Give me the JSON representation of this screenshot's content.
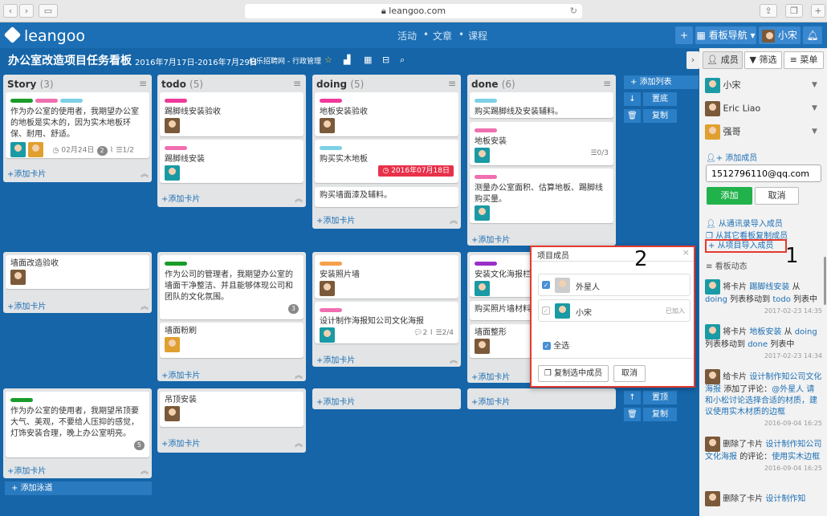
{
  "browser": {
    "url": "leangoo.com"
  },
  "app": {
    "logo": "leangoo",
    "nav": [
      "活动",
      "文章",
      "课程"
    ],
    "board_nav_label": "看板导航",
    "user_name": "小宋",
    "plus_label": "+"
  },
  "board": {
    "title": "办公室改造项目任务看板",
    "dates": "2016年7月17日-2016年7月29日",
    "org": "伯乐招聘网 - 行政管理"
  },
  "lists": [
    {
      "name": "Story",
      "count": "(3)"
    },
    {
      "name": "todo",
      "count": "(5)"
    },
    {
      "name": "doing",
      "count": "(5)"
    },
    {
      "name": "done",
      "count": "(6)"
    }
  ],
  "cards": {
    "story1": "作为办公室的使用者，我期望办公室的地板是实木的，因为实木地板环保、耐用、舒适。",
    "story1_date": "02月24日",
    "story1_comments": "2",
    "story1_check": "1/2",
    "story2": "墙面改造验收",
    "story3": "作为办公室的使用者，我期望吊顶要大气、美观，不要给人压抑的感觉，灯饰安装合理，晚上办公室明亮。",
    "story3_badge": "5",
    "todo1": "踢脚线安装验收",
    "todo2": "踢脚线安装",
    "todo3": "作为公司的管理者，我期望办公室的墙面干净整洁、并且能够体现公司和团队的文化氛围。",
    "todo3_badge": "3",
    "todo4": "墙面粉刷",
    "todo5": "吊顶安装",
    "doing1": "地板安装验收",
    "doing2": "购买实木地板",
    "doing2_due": "2016年07月18日",
    "doing3": "购买墙面漆及辅料。",
    "doing4": "安装照片墙",
    "doing5": "设计制作海报知公司文化海报",
    "doing5_comments": "2",
    "doing5_check": "2/4",
    "done1": "购买踢脚线及安装辅料。",
    "done2": "地板安装",
    "done2_check": "0/3",
    "done3": "测量办公室面积、估算地板、踢脚线购买量。",
    "done4": "安装文化海报栏",
    "done5": "购买照片墙材料",
    "done6": "墙面整形"
  },
  "list_actions": {
    "add_card": "添加卡片",
    "add_list": "添加列表",
    "top": "置底",
    "copy": "复制",
    "top2": "置顶",
    "add_lane": "添加泳道"
  },
  "sidebar": {
    "tabs": [
      "成员",
      "筛选",
      "菜单"
    ],
    "members": [
      "小宋",
      "Eric Liao",
      "强哥"
    ],
    "add_member": "添加成员",
    "email_value": "1512796110@qq.com",
    "add_btn": "添加",
    "cancel_btn": "取消",
    "import_contacts": "从通讯录导入成员",
    "copy_other": "从其它看板复制成员",
    "import_project": "从项目导入成员",
    "activity_title": "看板动态",
    "activities": [
      {
        "pre": "将卡片",
        "card": "踢脚线安装",
        "mid": "从",
        "from": "doing",
        "mid2": "列表移动到",
        "to": "todo",
        "post": "列表中",
        "time": "2017-02-23 14:35"
      },
      {
        "pre": "将卡片",
        "card": "地板安装",
        "mid": "从",
        "from": "doing",
        "mid2": "列表移动到",
        "to": "done",
        "post": "列表中",
        "time": "2017-02-23 14:34"
      },
      {
        "pre": "给卡片",
        "card": "设计制作知公司文化海报",
        "mid": "添加了评论：",
        "from": "@外星人 请和小松讨论选择合适的材质，建议使用实木材质的边框",
        "mid2": "",
        "to": "",
        "post": "",
        "time": "2016-09-04 16:25"
      },
      {
        "pre": "删除了卡片",
        "card": "设计制作知公司文化海报",
        "mid": "的评论：",
        "from": "使用实木边框",
        "mid2": "",
        "to": "",
        "post": "",
        "time": "2016-09-04 16:25"
      },
      {
        "pre": "删除了卡片",
        "card": "设计制作知",
        "mid": "",
        "from": "",
        "mid2": "",
        "to": "",
        "post": "",
        "time": ""
      }
    ]
  },
  "modal": {
    "title": "项目成员",
    "members": [
      {
        "name": "外星人",
        "note": ""
      },
      {
        "name": "小宋",
        "note": "已加入"
      }
    ],
    "select_all": "全选",
    "copy_btn": "复制选中成员",
    "cancel_btn": "取消"
  },
  "annotations": [
    "1",
    "2"
  ]
}
